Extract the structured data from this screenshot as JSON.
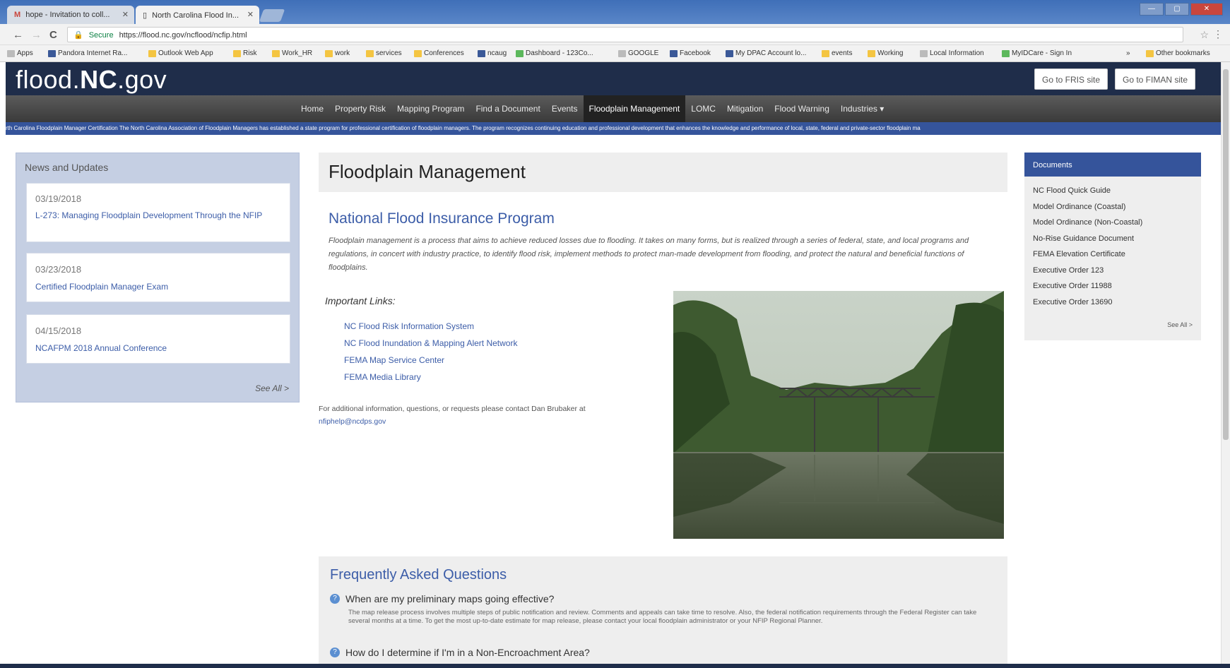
{
  "browser": {
    "tabs": [
      {
        "label": "hope - Invitation to coll...",
        "icon": "gmail-icon"
      },
      {
        "label": "North Carolina Flood In...",
        "icon": "page-icon"
      }
    ],
    "nav": {
      "back": "←",
      "forward": "→",
      "reload": "C"
    },
    "url_secure_label": "Secure",
    "url": "https://flood.nc.gov/ncflood/ncfip.html",
    "bookmarks": [
      "Apps",
      "Pandora Internet Ra...",
      "Outlook Web App",
      "Risk",
      "Work_HR",
      "work",
      "services",
      "Conferences",
      "ncaug",
      "Dashboard - 123Co...",
      "GOOGLE",
      "Facebook",
      "My DPAC Account lo...",
      "events",
      "Working",
      "Local Information",
      "MyIDCare - Sign In",
      "»",
      "Other bookmarks"
    ]
  },
  "site": {
    "logo_light": "flood.",
    "logo_bold": "NC",
    "logo_tail": ".gov",
    "top_buttons": [
      "Go to FRIS site",
      "Go to FIMAN site"
    ],
    "nav_items": [
      "Home",
      "Property Risk",
      "Mapping Program",
      "Find a Document",
      "Events",
      "Floodplain Management",
      "LOMC",
      "Mitigation",
      "Flood Warning",
      "Industries ▾"
    ],
    "nav_active": "Floodplain Management",
    "ticker": "rth Carolina Floodplain Manager Certification The North Carolina Association of Floodplain Managers has established a state program for professional certification of floodplain managers. The program recognizes continuing education and professional development that enhances the knowledge and performance of local, state, federal and private-sector floodplain ma"
  },
  "news": {
    "heading": "News and Updates",
    "items": [
      {
        "date": "03/19/2018",
        "title": "L-273: Managing Floodplain Development Through the NFIP"
      },
      {
        "date": "03/23/2018",
        "title": "Certified Floodplain Manager Exam"
      },
      {
        "date": "04/15/2018",
        "title": "NCAFPM 2018 Annual Conference"
      }
    ],
    "see_all": "See All >"
  },
  "main": {
    "page_title": "Floodplain Management",
    "section_title": "National Flood Insurance Program",
    "description": "Floodplain management is a process that aims to achieve reduced losses due to flooding. It takes on many forms, but is realized through a series of federal, state, and local programs and regulations, in concert with industry practice, to identify flood risk, implement methods to protect man-made development from flooding, and protect the natural and beneficial functions of floodplains.",
    "important_links_label": "Important Links:",
    "links": [
      "NC Flood Risk Information System",
      "NC Flood Inundation & Mapping Alert Network",
      "FEMA Map Service Center",
      "FEMA Media Library"
    ],
    "contact_text": "For additional information, questions, or requests please contact Dan Brubaker at",
    "contact_email": "nfiphelp@ncdps.gov"
  },
  "faq": {
    "heading": "Frequently Asked Questions",
    "q1": "When are my preliminary maps going effective?",
    "a1": "The map release process involves multiple steps of public notification and review. Comments and appeals can take time to resolve. Also, the federal notification requirements through the Federal Register can take several months at a time. To get the most up-to-date estimate for map release, please contact your local floodplain administrator or your NFIP Regional Planner.",
    "q2": "How do I determine if I'm in a Non-Encroachment Area?"
  },
  "documents": {
    "heading": "Documents",
    "items": [
      "NC Flood Quick Guide",
      "Model Ordinance (Coastal)",
      "Model Ordinance (Non-Coastal)",
      "No-Rise Guidance Document",
      "FEMA Elevation Certificate",
      "Executive Order 123",
      "Executive Order 11988",
      "Executive Order 13690"
    ],
    "see_all": "See All >"
  }
}
